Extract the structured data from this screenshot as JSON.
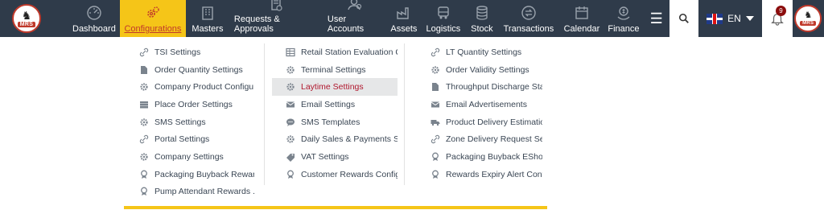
{
  "brand": {
    "logo_text": "MRS"
  },
  "nav": [
    {
      "label": "Dashboard",
      "icon": "dashboard-icon"
    },
    {
      "label": "Configurations",
      "icon": "gears-icon",
      "active": true
    },
    {
      "label": "Masters",
      "icon": "building-icon"
    },
    {
      "label": "Requests & Approvals",
      "icon": "document-check-icon"
    },
    {
      "label": "User Accounts",
      "icon": "users-icon"
    },
    {
      "label": "Assets",
      "icon": "factory-icon"
    },
    {
      "label": "Logistics",
      "icon": "truck-icon"
    },
    {
      "label": "Stock",
      "icon": "database-icon"
    },
    {
      "label": "Transactions",
      "icon": "exchange-icon"
    },
    {
      "label": "Calendar",
      "icon": "calendar-icon"
    },
    {
      "label": "Finance",
      "icon": "money-icon"
    }
  ],
  "language": {
    "code": "EN"
  },
  "notifications": {
    "count": "9"
  },
  "configurations_menu": {
    "column1": [
      {
        "label": "TSI Settings",
        "icon": "link-icon"
      },
      {
        "label": "Order Quantity Settings",
        "icon": "file-icon"
      },
      {
        "label": "Company Product Configu...",
        "icon": "gear-icon"
      },
      {
        "label": "Place Order Settings",
        "icon": "server-icon"
      },
      {
        "label": "SMS Settings",
        "icon": "gear-icon"
      },
      {
        "label": "Portal Settings",
        "icon": "link-icon"
      },
      {
        "label": "Company Settings",
        "icon": "gear-icon"
      },
      {
        "label": "Packaging Buyback Reward",
        "icon": "award-icon"
      },
      {
        "label": "Pump Attendant Rewards ...",
        "icon": "award-icon"
      }
    ],
    "column2": [
      {
        "label": "Retail Station Evaluation Q...",
        "icon": "table-icon"
      },
      {
        "label": "Terminal Settings",
        "icon": "gear-icon"
      },
      {
        "label": "Laytime Settings",
        "icon": "gear-icon",
        "highlighted": true
      },
      {
        "label": "Email Settings",
        "icon": "envelope-icon"
      },
      {
        "label": "SMS Templates",
        "icon": "chat-icon"
      },
      {
        "label": "Daily Sales & Payments Set...",
        "icon": "gear-icon"
      },
      {
        "label": "VAT Settings",
        "icon": "tag-icon"
      },
      {
        "label": "Customer Rewards Config...",
        "icon": "award-icon"
      }
    ],
    "column3": [
      {
        "label": "LT Quantity Settings",
        "icon": "link-icon"
      },
      {
        "label": "Order Validity Settings",
        "icon": "gear-icon"
      },
      {
        "label": "Throughput Discharge Stat...",
        "icon": "file-icon"
      },
      {
        "label": "Email Advertisements",
        "icon": "envelope-icon"
      },
      {
        "label": "Product Delivery Estimatio...",
        "icon": "truck-icon"
      },
      {
        "label": "Zone Delivery Request Set...",
        "icon": "link-icon"
      },
      {
        "label": "Packaging Buyback EShop ...",
        "icon": "award-icon"
      },
      {
        "label": "Rewards Expiry Alert Confi...",
        "icon": "award-icon"
      }
    ]
  },
  "colors": {
    "topbar": "#2f3b4a",
    "active_tab": "#f5c518",
    "active_text": "#c0392b",
    "highlight_bg": "#e6e7e8",
    "highlight_text": "#b0182e"
  }
}
